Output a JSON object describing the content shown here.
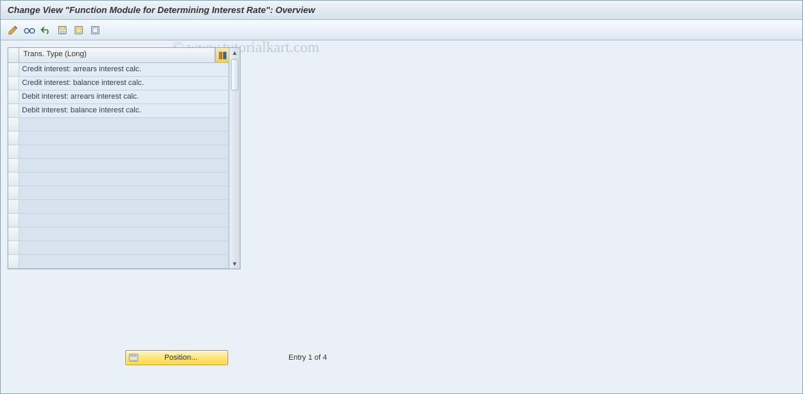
{
  "header": {
    "title": "Change View \"Function Module for Determining Interest Rate\": Overview"
  },
  "toolbar": {
    "icons": [
      "change-icon",
      "glasses-icon",
      "undo-icon",
      "save-icon",
      "select-all-icon",
      "deselect-all-icon"
    ]
  },
  "watermark": "©  www.tutorialkart.com",
  "table": {
    "column_header": "Trans. Type (Long)",
    "rows": [
      "Credit interest: arrears interest calc.",
      "Credit interest: balance interest calc.",
      "Debit interest: arrears interest calc.",
      "Debit interest: balance interest calc."
    ],
    "visible_row_slots": 15
  },
  "footer": {
    "position_label": "Position...",
    "entry_status": "Entry 1 of 4"
  }
}
